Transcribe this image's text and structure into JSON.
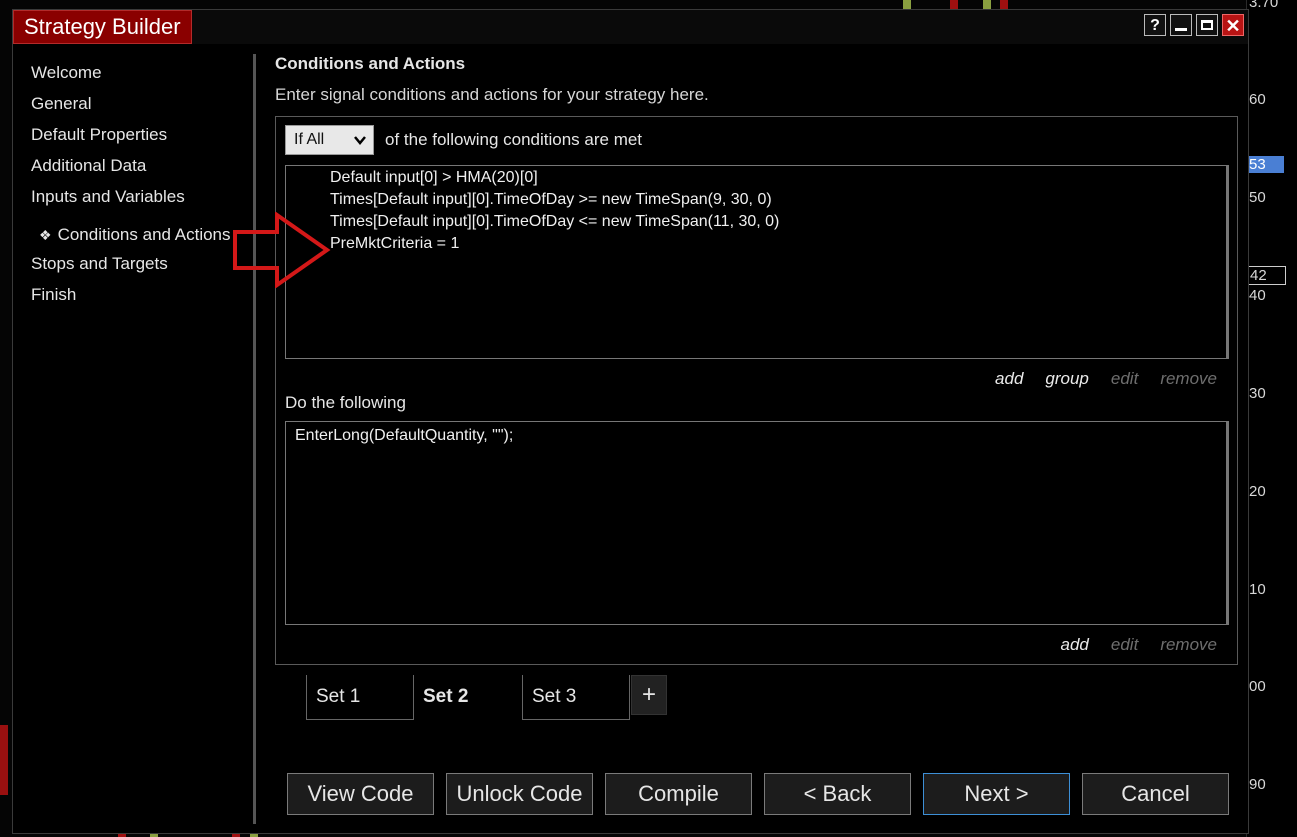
{
  "background_axis": {
    "ticks": [
      "3.70",
      "60",
      "53",
      "50",
      "42",
      "40",
      "30",
      "20",
      "10",
      "00",
      "90"
    ]
  },
  "window": {
    "title": "Strategy Builder",
    "buttons": {
      "help": "?"
    }
  },
  "nav": {
    "items": [
      {
        "label": "Welcome"
      },
      {
        "label": "General"
      },
      {
        "label": "Default Properties"
      },
      {
        "label": "Additional Data"
      },
      {
        "label": "Inputs and Variables"
      },
      {
        "label": "Conditions and Actions",
        "active": true,
        "bullet": "❖"
      },
      {
        "label": "Stops and Targets"
      },
      {
        "label": "Finish"
      }
    ]
  },
  "content": {
    "heading": "Conditions and Actions",
    "subheading": "Enter signal conditions and actions for your strategy here.",
    "condition_select": {
      "value": "If All"
    },
    "condition_label": "of the following conditions are met",
    "conditions": [
      "Default input[0] > HMA(20)[0]",
      "Times[Default input][0].TimeOfDay >= new TimeSpan(9, 30, 0)",
      "Times[Default input][0].TimeOfDay <= new TimeSpan(11, 30, 0)",
      "PreMktCriteria = 1"
    ],
    "condition_links": {
      "add": "add",
      "group": "group",
      "edit": "edit",
      "remove": "remove"
    },
    "actions_label": "Do the following",
    "actions": [
      "EnterLong(DefaultQuantity, \"\");"
    ],
    "action_links": {
      "add": "add",
      "edit": "edit",
      "remove": "remove"
    }
  },
  "sets": {
    "tabs": [
      "Set 1",
      "Set 2",
      "Set 3"
    ],
    "selected": "Set 2",
    "add_label": "+"
  },
  "footer": {
    "view_code": "View Code",
    "unlock_code": "Unlock Code",
    "compile": "Compile",
    "back": "< Back",
    "next": "Next >",
    "cancel": "Cancel"
  },
  "colors": {
    "title_bg": "#8a0000",
    "close_bg": "#b81414",
    "annotation_arrow": "#d41818",
    "focus_border": "#3d8fd6"
  }
}
